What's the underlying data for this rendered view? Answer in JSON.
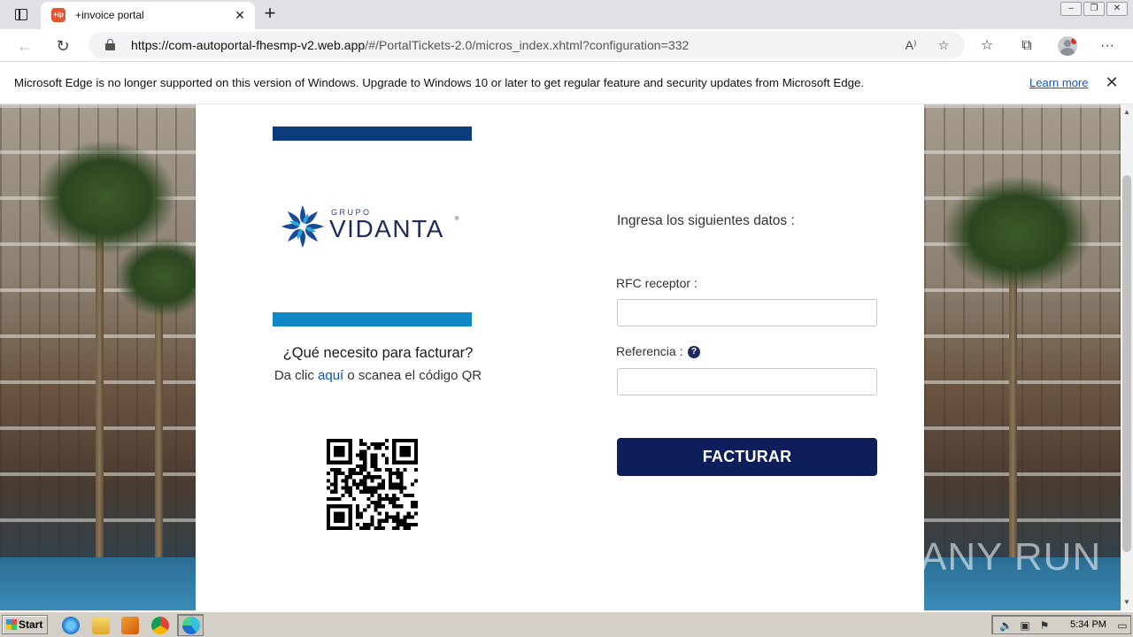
{
  "browser": {
    "tab": {
      "title": "+invoice portal",
      "favicon_text": "+ip"
    },
    "new_tab_label": "+",
    "window_controls": [
      "–",
      "❐",
      "✕"
    ],
    "url_host": "https://com-autoportal-fhesmp-v2.web.app",
    "url_path": "/#/PortalTickets-2.0/micros_index.xhtml?configuration=332"
  },
  "infobar": {
    "message": "Microsoft Edge is no longer supported on this version of Windows. Upgrade to Windows 10 or later to get regular feature and security updates from Microsoft Edge.",
    "learn_more": "Learn more"
  },
  "page": {
    "logo_small": "GRUPO",
    "logo_big": "VIDANTA",
    "logo_reg": "®",
    "question": "¿Qué necesito para facturar?",
    "instr_pre": "Da clic ",
    "instr_link": "aquí",
    "instr_post": " o scanea el código QR",
    "form_heading": "Ingresa los siguientes datos :",
    "rfc_label": "RFC receptor :",
    "rfc_value": "",
    "ref_label": "Referencia :",
    "ref_value": "",
    "help_icon": "?",
    "submit_label": "FACTURAR",
    "colors": {
      "top_bar": "#0c3c7c",
      "mid_bar": "#0f86c6",
      "button": "#0d1e5a",
      "link": "#0c54b8"
    }
  },
  "watermark": "ANY RUN",
  "taskbar": {
    "start_label": "Start",
    "clock": "5:34 PM",
    "icons": [
      "ie-icon",
      "folder-icon",
      "media-player-icon",
      "chrome-icon",
      "edge-icon"
    ]
  }
}
